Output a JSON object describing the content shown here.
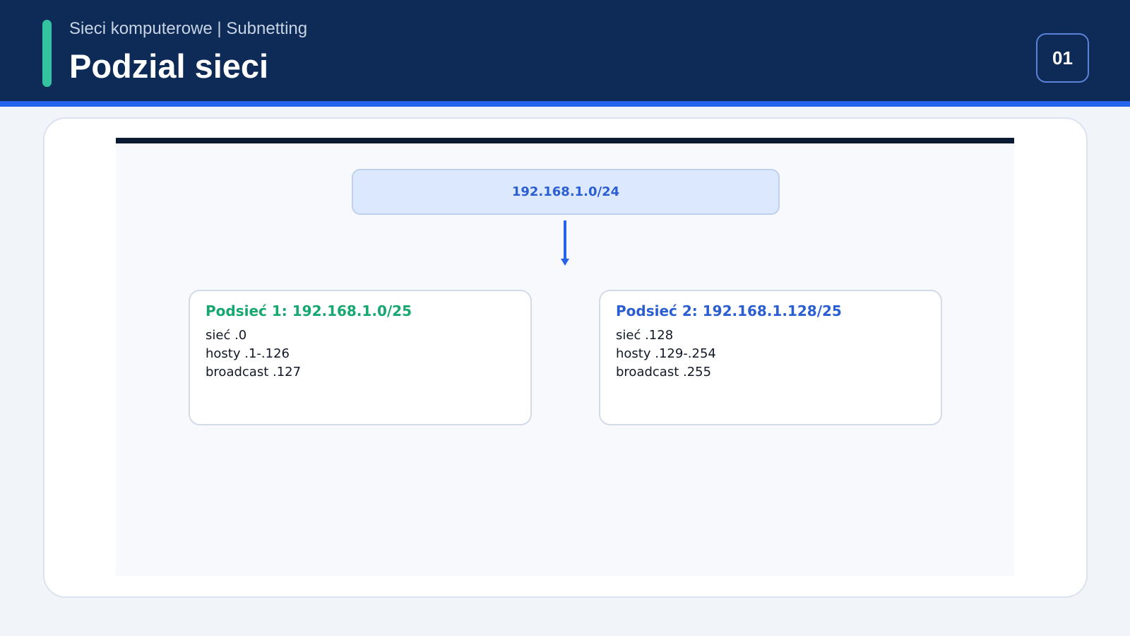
{
  "header": {
    "subtitle": "Sieci komputerowe | Subnetting",
    "title": "Podzial sieci",
    "page_number": "01"
  },
  "diagram": {
    "root": {
      "label": "192.168.1.0/24"
    },
    "subnets": [
      {
        "title": "Podsieć 1: 192.168.1.0/25",
        "lines": [
          "sieć .0",
          "hosty .1-.126",
          "broadcast .127"
        ]
      },
      {
        "title": "Podsieć 2: 192.168.1.128/25",
        "lines": [
          "sieć .128",
          "hosty .129-.254",
          "broadcast .255"
        ]
      }
    ]
  },
  "colors": {
    "header_bg": "#0d2b56",
    "accent_stripe": "#2563eb",
    "accent_bar": "#34c3a0",
    "subnet1_title": "#16a870",
    "subnet2_title": "#2a5ed1",
    "arrow": "#2563eb"
  }
}
